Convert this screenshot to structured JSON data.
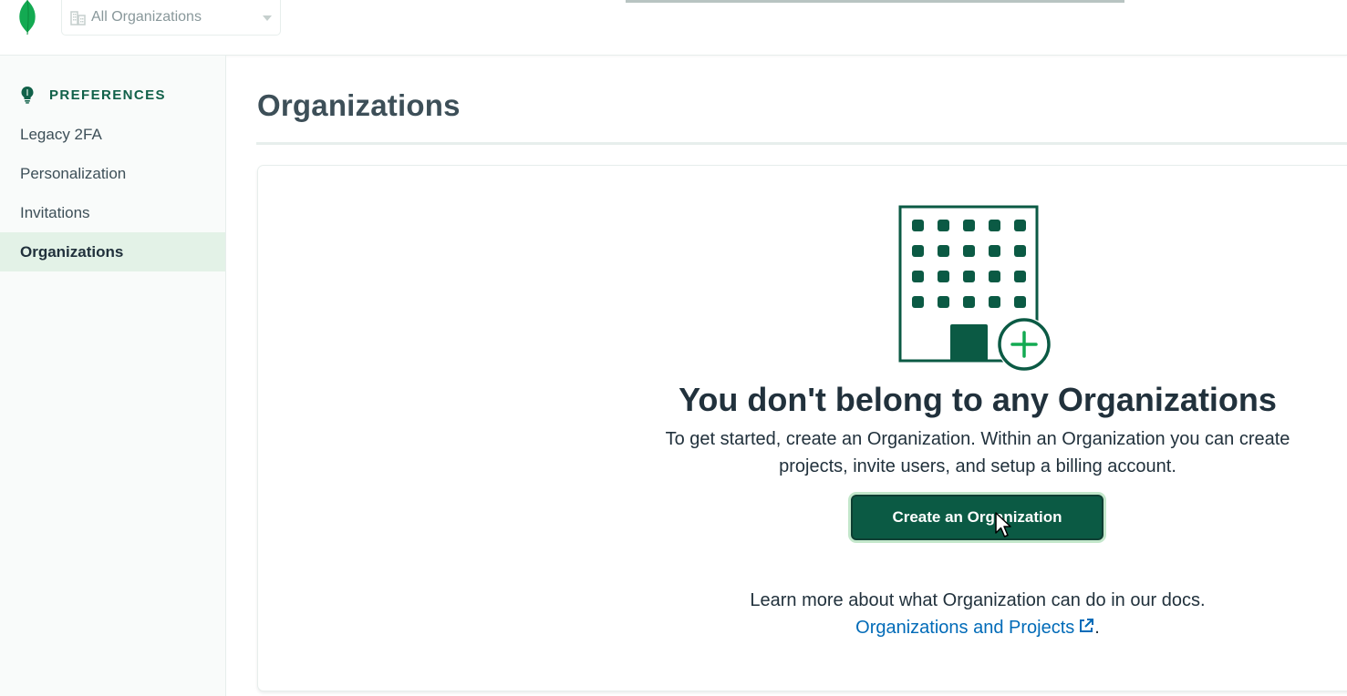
{
  "header": {
    "org_selector": {
      "label": "All Organizations",
      "icon": "building-icon"
    }
  },
  "sidebar": {
    "section_title": "PREFERENCES",
    "section_icon": "lightbulb-icon",
    "items": [
      {
        "label": "Legacy 2FA",
        "active": false
      },
      {
        "label": "Personalization",
        "active": false
      },
      {
        "label": "Invitations",
        "active": false
      },
      {
        "label": "Organizations",
        "active": true
      }
    ]
  },
  "main": {
    "title": "Organizations",
    "empty_state": {
      "heading": "You don't belong to any Organizations",
      "description": "To get started, create an Organization. Within an Organization you can create projects, invite users, and setup a billing account.",
      "button_label": "Create an Organization",
      "learn_more_text": "Learn more about what Organization can do in our docs.",
      "link_text": "Organizations and Projects",
      "link_suffix": "."
    }
  },
  "colors": {
    "brand_green": "#0b5a44",
    "sidebar_active_bg": "#e3f2e7",
    "link_blue": "#016bb8",
    "plus_green": "#13aa52"
  }
}
